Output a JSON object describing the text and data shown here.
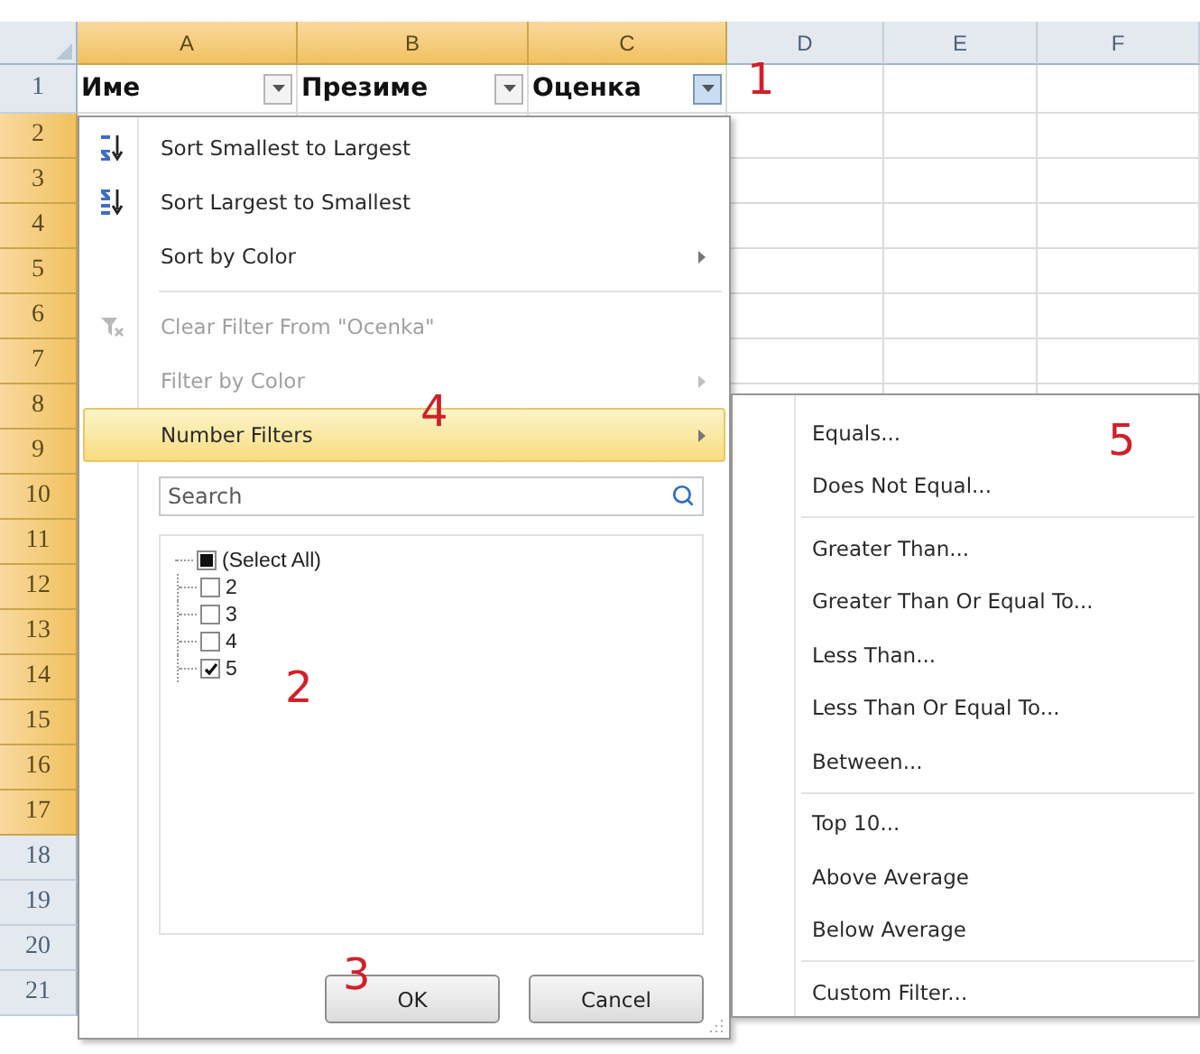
{
  "columns": [
    {
      "label": "A",
      "selected": true
    },
    {
      "label": "B",
      "selected": true
    },
    {
      "label": "C",
      "selected": true
    },
    {
      "label": "D",
      "selected": false
    },
    {
      "label": "E",
      "selected": false
    },
    {
      "label": "F",
      "selected": false
    }
  ],
  "rows": [
    {
      "label": "1",
      "selected": false
    },
    {
      "label": "2",
      "selected": true
    },
    {
      "label": "3",
      "selected": true
    },
    {
      "label": "4",
      "selected": true
    },
    {
      "label": "5",
      "selected": true
    },
    {
      "label": "6",
      "selected": true
    },
    {
      "label": "7",
      "selected": true
    },
    {
      "label": "8",
      "selected": true
    },
    {
      "label": "9",
      "selected": true
    },
    {
      "label": "10",
      "selected": true
    },
    {
      "label": "11",
      "selected": true
    },
    {
      "label": "12",
      "selected": true
    },
    {
      "label": "13",
      "selected": true
    },
    {
      "label": "14",
      "selected": true
    },
    {
      "label": "15",
      "selected": true
    },
    {
      "label": "16",
      "selected": true
    },
    {
      "label": "17",
      "selected": true
    },
    {
      "label": "18",
      "selected": false
    },
    {
      "label": "19",
      "selected": false
    },
    {
      "label": "20",
      "selected": false
    },
    {
      "label": "21",
      "selected": false
    }
  ],
  "header_cells": [
    {
      "text": "Име",
      "filter_active": false
    },
    {
      "text": "Презиме",
      "filter_active": false
    },
    {
      "text": "Оценка",
      "filter_active": true
    }
  ],
  "filter_menu": {
    "items": [
      {
        "kind": "sort_ascending",
        "label": "Sort Smallest to Largest",
        "disabled": false,
        "submenu": false,
        "selected": false
      },
      {
        "kind": "sort_descending",
        "label": "Sort Largest to Smallest",
        "disabled": false,
        "submenu": false,
        "selected": false
      },
      {
        "kind": "plain",
        "label": "Sort by Color",
        "disabled": false,
        "submenu": true,
        "selected": false
      },
      {
        "kind": "separator"
      },
      {
        "kind": "clear_filter",
        "label": "Clear Filter From \"Ocenka\"",
        "disabled": true,
        "submenu": false,
        "selected": false
      },
      {
        "kind": "plain",
        "label": "Filter by Color",
        "disabled": true,
        "submenu": true,
        "selected": false
      },
      {
        "kind": "plain",
        "label": "Number Filters",
        "disabled": false,
        "submenu": true,
        "selected": true
      }
    ],
    "search": {
      "placeholder": "Search"
    },
    "values": {
      "label": "(Select All)",
      "indeterminate": true,
      "children": [
        {
          "label": "2",
          "checked": false
        },
        {
          "label": "3",
          "checked": false
        },
        {
          "label": "4",
          "checked": false
        },
        {
          "label": "5",
          "checked": true
        }
      ]
    },
    "buttons": [
      "OK",
      "Cancel"
    ]
  },
  "submenu": {
    "items": [
      {
        "kind": "item",
        "label": "Equals..."
      },
      {
        "kind": "item",
        "label": "Does Not Equal..."
      },
      {
        "kind": "separator"
      },
      {
        "kind": "item",
        "label": "Greater Than..."
      },
      {
        "kind": "item",
        "label": "Greater Than Or Equal To..."
      },
      {
        "kind": "item",
        "label": "Less Than..."
      },
      {
        "kind": "item",
        "label": "Less Than Or Equal To..."
      },
      {
        "kind": "item",
        "label": "Between..."
      },
      {
        "kind": "separator"
      },
      {
        "kind": "item",
        "label": "Top 10..."
      },
      {
        "kind": "item",
        "label": "Above Average"
      },
      {
        "kind": "item",
        "label": "Below Average"
      },
      {
        "kind": "separator"
      },
      {
        "kind": "item",
        "label": "Custom Filter..."
      }
    ]
  },
  "annotations": [
    "1",
    "4",
    "2",
    "3",
    "5"
  ]
}
